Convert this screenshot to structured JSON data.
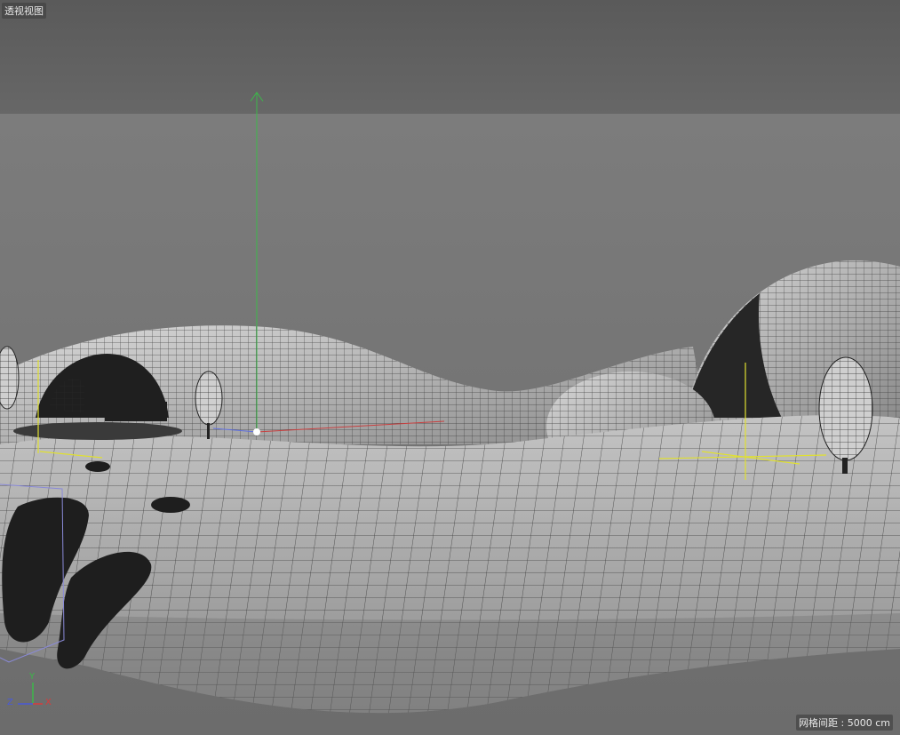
{
  "viewport": {
    "view_name": "透视视图",
    "grid_spacing_label": "网格间距 : 5000 cm"
  },
  "axis_gizmo": {
    "y_label": "Y",
    "x_label": "X",
    "z_label": "Z",
    "colors": {
      "x": "#d83c3c",
      "y": "#3cb84a",
      "z": "#4a5ad8"
    }
  },
  "colors": {
    "sky_top": "#5e5e5e",
    "horizon": "#7b7b7b",
    "terrain": "#a9a9a9",
    "wire": "#2a2a2a",
    "object_dark": "#1e1e1e",
    "light_helper": "#e0e030"
  }
}
